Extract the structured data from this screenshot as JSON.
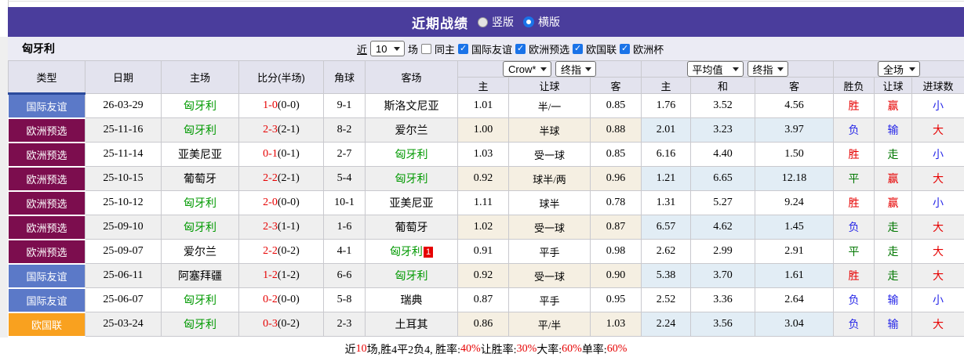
{
  "colors": {
    "title_bar_bg": "#4a3d9c",
    "friendly_badge": "#5b79c8",
    "qualifier_badge": "#7c0d4e",
    "nations_badge": "#f9a11f",
    "checkbox_blue": "#1a73e8",
    "win_red": "#e60000",
    "lose_blue": "#2727e8",
    "draw_green": "#007700",
    "hungary_green": "#009900",
    "odds_col_bg": "#fcf6ea",
    "avg_col_bg": "#e9f3fa"
  },
  "title_bar": {
    "title": "近期战绩",
    "layout_options": [
      {
        "label": "竖版",
        "selected": false
      },
      {
        "label": "横版",
        "selected": true
      }
    ]
  },
  "filter_bar": {
    "team": "匈牙利",
    "recent_label": "近",
    "recent_count": "10",
    "games_label": "场",
    "same_home": {
      "label": "同主",
      "checked": false
    },
    "competitions": [
      {
        "label": "国际友谊",
        "checked": true
      },
      {
        "label": "欧洲预选",
        "checked": true
      },
      {
        "label": "欧国联",
        "checked": true
      },
      {
        "label": "欧洲杯",
        "checked": true
      }
    ]
  },
  "table": {
    "main_headers": [
      "类型",
      "日期",
      "主场",
      "比分(半场)",
      "角球",
      "客场"
    ],
    "sub_headers": [
      "主",
      "让球",
      "客",
      "主",
      "和",
      "客",
      "胜负",
      "让球",
      "进球数"
    ],
    "selects": {
      "bookmaker": "Crow*",
      "bookmaker_stage": "终指",
      "average": "平均值",
      "average_stage": "终指",
      "scope": "全场"
    },
    "rows": [
      {
        "type": "国际友谊",
        "type_class": "friendly",
        "date": "26-03-29",
        "home": "匈牙利",
        "home_green": true,
        "score_ft": "1-0",
        "score_ht": "(0-0)",
        "corner": "9-1",
        "away": "斯洛文尼亚",
        "away_green": false,
        "away_badge": "",
        "odds": [
          "1.01",
          "半/一",
          "0.85"
        ],
        "avg": [
          "1.76",
          "3.52",
          "4.56"
        ],
        "results": [
          {
            "text": "胜",
            "color": "red"
          },
          {
            "text": "赢",
            "color": "red"
          },
          {
            "text": "小",
            "color": "blue"
          }
        ]
      },
      {
        "type": "欧洲预选",
        "type_class": "qualifier",
        "date": "25-11-16",
        "home": "匈牙利",
        "home_green": true,
        "score_ft": "2-3",
        "score_ht": "(2-1)",
        "corner": "8-2",
        "away": "爱尔兰",
        "away_green": false,
        "away_badge": "",
        "odds": [
          "1.00",
          "半球",
          "0.88"
        ],
        "avg": [
          "2.01",
          "3.23",
          "3.97"
        ],
        "results": [
          {
            "text": "负",
            "color": "blue"
          },
          {
            "text": "输",
            "color": "blue"
          },
          {
            "text": "大",
            "color": "red"
          }
        ]
      },
      {
        "type": "欧洲预选",
        "type_class": "qualifier",
        "date": "25-11-14",
        "home": "亚美尼亚",
        "home_green": false,
        "score_ft": "0-1",
        "score_ht": "(0-1)",
        "corner": "2-7",
        "away": "匈牙利",
        "away_green": true,
        "away_badge": "",
        "odds": [
          "1.03",
          "受一球",
          "0.85"
        ],
        "avg": [
          "6.16",
          "4.40",
          "1.50"
        ],
        "results": [
          {
            "text": "胜",
            "color": "red"
          },
          {
            "text": "走",
            "color": "green"
          },
          {
            "text": "小",
            "color": "blue"
          }
        ]
      },
      {
        "type": "欧洲预选",
        "type_class": "qualifier",
        "date": "25-10-15",
        "home": "葡萄牙",
        "home_green": false,
        "score_ft": "2-2",
        "score_ht": "(2-1)",
        "corner": "5-4",
        "away": "匈牙利",
        "away_green": true,
        "away_badge": "",
        "odds": [
          "0.92",
          "球半/两",
          "0.96"
        ],
        "avg": [
          "1.21",
          "6.65",
          "12.18"
        ],
        "results": [
          {
            "text": "平",
            "color": "green"
          },
          {
            "text": "赢",
            "color": "red"
          },
          {
            "text": "大",
            "color": "red"
          }
        ]
      },
      {
        "type": "欧洲预选",
        "type_class": "qualifier",
        "date": "25-10-12",
        "home": "匈牙利",
        "home_green": true,
        "score_ft": "2-0",
        "score_ht": "(0-0)",
        "corner": "10-1",
        "away": "亚美尼亚",
        "away_green": false,
        "away_badge": "",
        "odds": [
          "1.11",
          "球半",
          "0.78"
        ],
        "avg": [
          "1.31",
          "5.27",
          "9.24"
        ],
        "results": [
          {
            "text": "胜",
            "color": "red"
          },
          {
            "text": "赢",
            "color": "red"
          },
          {
            "text": "小",
            "color": "blue"
          }
        ]
      },
      {
        "type": "欧洲预选",
        "type_class": "qualifier",
        "date": "25-09-10",
        "home": "匈牙利",
        "home_green": true,
        "score_ft": "2-3",
        "score_ht": "(1-1)",
        "corner": "1-6",
        "away": "葡萄牙",
        "away_green": false,
        "away_badge": "",
        "odds": [
          "1.02",
          "受一球",
          "0.87"
        ],
        "avg": [
          "6.57",
          "4.62",
          "1.45"
        ],
        "results": [
          {
            "text": "负",
            "color": "blue"
          },
          {
            "text": "走",
            "color": "green"
          },
          {
            "text": "大",
            "color": "red"
          }
        ]
      },
      {
        "type": "欧洲预选",
        "type_class": "qualifier",
        "date": "25-09-07",
        "home": "爱尔兰",
        "home_green": false,
        "score_ft": "2-2",
        "score_ht": "(0-2)",
        "corner": "4-1",
        "away": "匈牙利",
        "away_green": true,
        "away_badge": "1",
        "odds": [
          "0.91",
          "平手",
          "0.98"
        ],
        "avg": [
          "2.62",
          "2.99",
          "2.91"
        ],
        "results": [
          {
            "text": "平",
            "color": "green"
          },
          {
            "text": "走",
            "color": "green"
          },
          {
            "text": "大",
            "color": "red"
          }
        ]
      },
      {
        "type": "国际友谊",
        "type_class": "friendly",
        "date": "25-06-11",
        "home": "阿塞拜疆",
        "home_green": false,
        "score_ft": "1-2",
        "score_ht": "(1-2)",
        "corner": "6-6",
        "away": "匈牙利",
        "away_green": true,
        "away_badge": "",
        "odds": [
          "0.92",
          "受一球",
          "0.90"
        ],
        "avg": [
          "5.38",
          "3.70",
          "1.61"
        ],
        "results": [
          {
            "text": "胜",
            "color": "red"
          },
          {
            "text": "走",
            "color": "green"
          },
          {
            "text": "大",
            "color": "red"
          }
        ]
      },
      {
        "type": "国际友谊",
        "type_class": "friendly",
        "date": "25-06-07",
        "home": "匈牙利",
        "home_green": true,
        "score_ft": "0-2",
        "score_ht": "(0-0)",
        "corner": "5-8",
        "away": "瑞典",
        "away_green": false,
        "away_badge": "",
        "odds": [
          "0.87",
          "平手",
          "0.95"
        ],
        "avg": [
          "2.52",
          "3.36",
          "2.64"
        ],
        "results": [
          {
            "text": "负",
            "color": "blue"
          },
          {
            "text": "输",
            "color": "blue"
          },
          {
            "text": "小",
            "color": "blue"
          }
        ]
      },
      {
        "type": "欧国联",
        "type_class": "nations",
        "date": "25-03-24",
        "home": "匈牙利",
        "home_green": true,
        "score_ft": "0-3",
        "score_ht": "(0-2)",
        "corner": "2-3",
        "away": "土耳其",
        "away_green": false,
        "away_badge": "",
        "odds": [
          "0.86",
          "平/半",
          "1.03"
        ],
        "avg": [
          "2.24",
          "3.56",
          "3.04"
        ],
        "results": [
          {
            "text": "负",
            "color": "blue"
          },
          {
            "text": "输",
            "color": "blue"
          },
          {
            "text": "大",
            "color": "red"
          }
        ]
      }
    ]
  },
  "footer": {
    "parts": [
      {
        "text": "近",
        "red": false
      },
      {
        "text": "10",
        "red": true
      },
      {
        "text": "场,胜4平2负4, 胜率:",
        "red": false
      },
      {
        "text": "40%",
        "red": true
      },
      {
        "text": " 让胜率:",
        "red": false
      },
      {
        "text": "30%",
        "red": true
      },
      {
        "text": " 大率:",
        "red": false
      },
      {
        "text": "60%",
        "red": true
      },
      {
        "text": " 单率:",
        "red": false
      },
      {
        "text": "60%",
        "red": true
      }
    ]
  }
}
